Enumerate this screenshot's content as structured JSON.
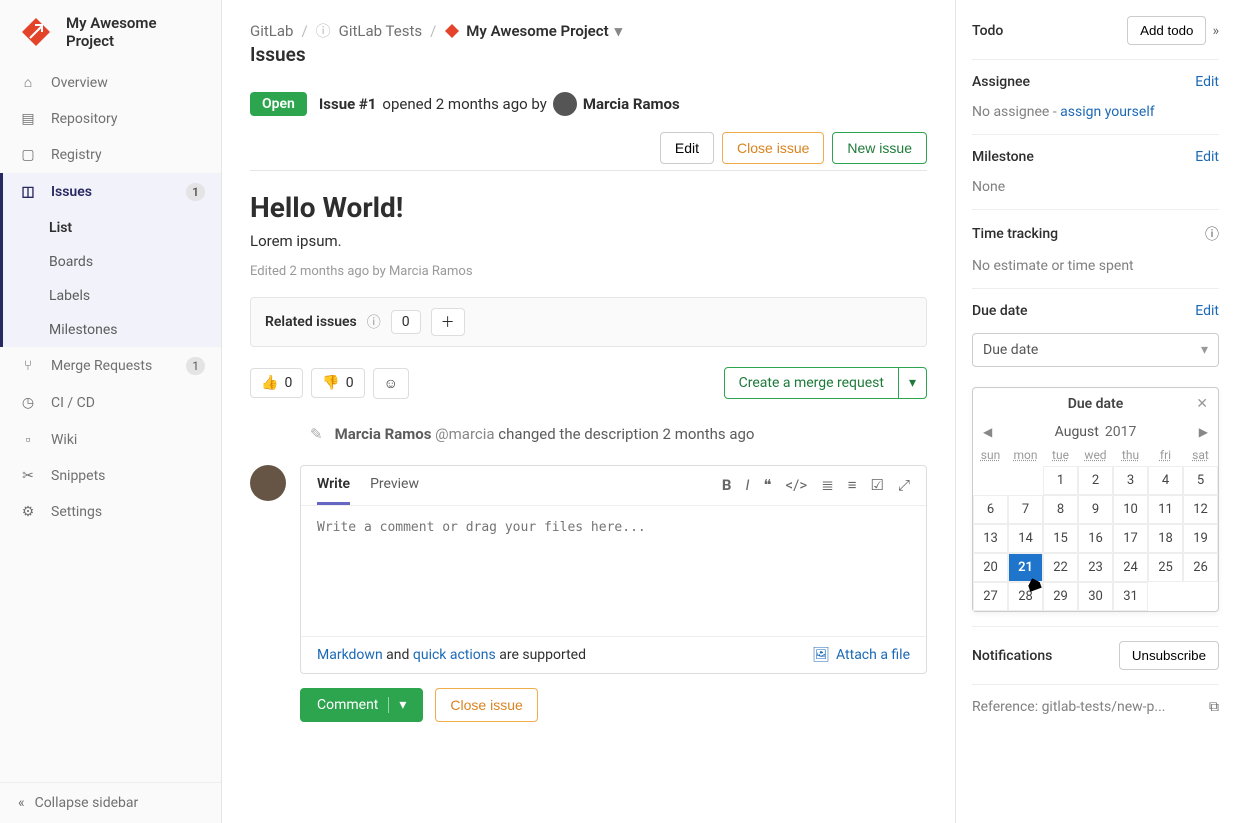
{
  "project": {
    "name": "My Awesome Project"
  },
  "sidebar": {
    "items": [
      {
        "label": "Overview"
      },
      {
        "label": "Repository"
      },
      {
        "label": "Registry"
      },
      {
        "label": "Issues",
        "badge": "1"
      },
      {
        "label": "Merge Requests",
        "badge": "1"
      },
      {
        "label": "CI / CD"
      },
      {
        "label": "Wiki"
      },
      {
        "label": "Snippets"
      },
      {
        "label": "Settings"
      }
    ],
    "issues_sub": [
      "List",
      "Boards",
      "Labels",
      "Milestones"
    ],
    "collapse": "Collapse sidebar"
  },
  "breadcrumbs": {
    "root": "GitLab",
    "group": "GitLab Tests",
    "project": "My Awesome Project"
  },
  "page_heading": "Issues",
  "issue": {
    "status": "Open",
    "id_label": "Issue #1",
    "opened_meta": "opened 2 months ago by",
    "author": "Marcia Ramos",
    "edit_btn": "Edit",
    "close_btn": "Close issue",
    "new_btn": "New issue",
    "title": "Hello World!",
    "body": "Lorem ipsum.",
    "edited": "Edited 2 months ago by Marcia Ramos"
  },
  "related": {
    "label": "Related issues",
    "count": "0"
  },
  "reactions": {
    "thumbs_up": "0",
    "thumbs_down": "0"
  },
  "merge_button": "Create a merge request",
  "activity": {
    "author": "Marcia Ramos",
    "handle": "@marcia",
    "text": "changed the description",
    "time": "2 months ago"
  },
  "comment": {
    "write_tab": "Write",
    "preview_tab": "Preview",
    "placeholder": "Write a comment or drag your files here...",
    "md_label": "Markdown",
    "and": " and ",
    "qa_label": "quick actions",
    "supported": " are supported",
    "attach": "Attach a file",
    "submit": "Comment",
    "close": "Close issue"
  },
  "right": {
    "todo_label": "Todo",
    "add_todo": "Add todo",
    "assignee_label": "Assignee",
    "assignee_text": "No assignee - ",
    "assign_self": "assign yourself",
    "edit": "Edit",
    "milestone_label": "Milestone",
    "milestone_value": "None",
    "tt_label": "Time tracking",
    "tt_value": "No estimate or time spent",
    "due_label": "Due date",
    "due_select": "Due date",
    "notif_label": "Notifications",
    "unsubscribe": "Unsubscribe",
    "reference": "Reference: gitlab-tests/new-p..."
  },
  "datepicker": {
    "title": "Due date",
    "month": "August",
    "year": "2017",
    "dow": [
      "sun",
      "mon",
      "tue",
      "wed",
      "thu",
      "fri",
      "sat"
    ],
    "leading_blanks": 2,
    "days_in_month": 31,
    "selected": 21
  }
}
